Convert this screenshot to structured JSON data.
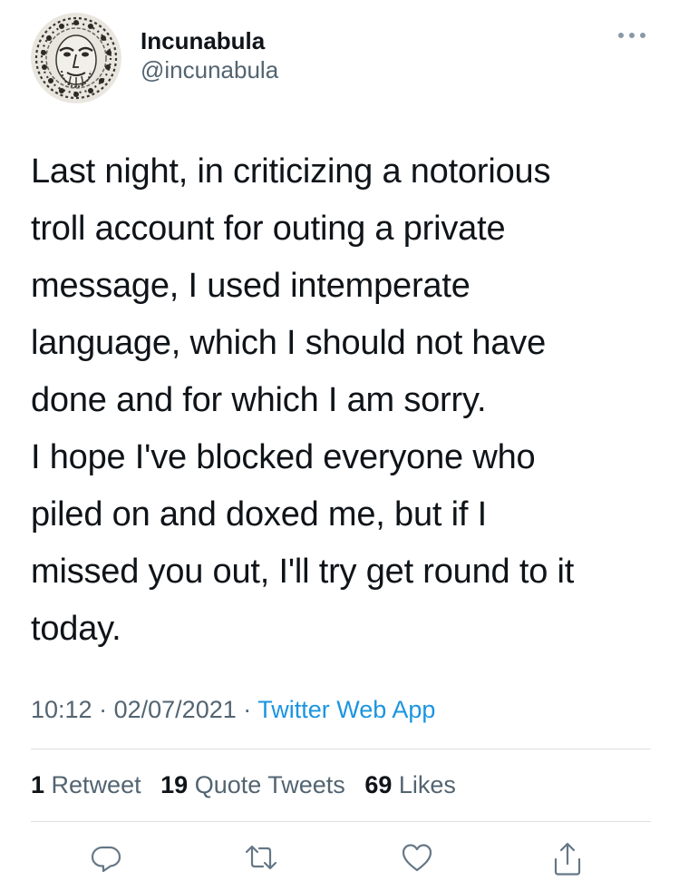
{
  "user": {
    "display_name": "Incunabula",
    "handle": "@incunabula",
    "avatar_icon": "woodcut-face-avatar"
  },
  "tweet": {
    "text": "Last night, in criticizing a notorious\ntroll account for outing a private\nmessage, I used intemperate\nlanguage, which I should not have\ndone and for which I am sorry.\nI hope I've blocked everyone who\npiled on and doxed me, but if I\nmissed you out, I'll try get round to it\ntoday.",
    "time": "10:12",
    "date": "02/07/2021",
    "separator": "·",
    "source": "Twitter Web App"
  },
  "stats": {
    "retweets": {
      "count": "1",
      "label": "Retweet"
    },
    "quotes": {
      "count": "19",
      "label": "Quote Tweets"
    },
    "likes": {
      "count": "69",
      "label": "Likes"
    }
  },
  "actions": [
    {
      "icon": "reply-icon"
    },
    {
      "icon": "retweet-icon"
    },
    {
      "icon": "like-icon"
    },
    {
      "icon": "share-icon"
    }
  ],
  "colors": {
    "text": "#0f1419",
    "secondary": "#536471",
    "link": "#1b95e0",
    "icon": "#657786",
    "divider": "#dcdfe2"
  }
}
